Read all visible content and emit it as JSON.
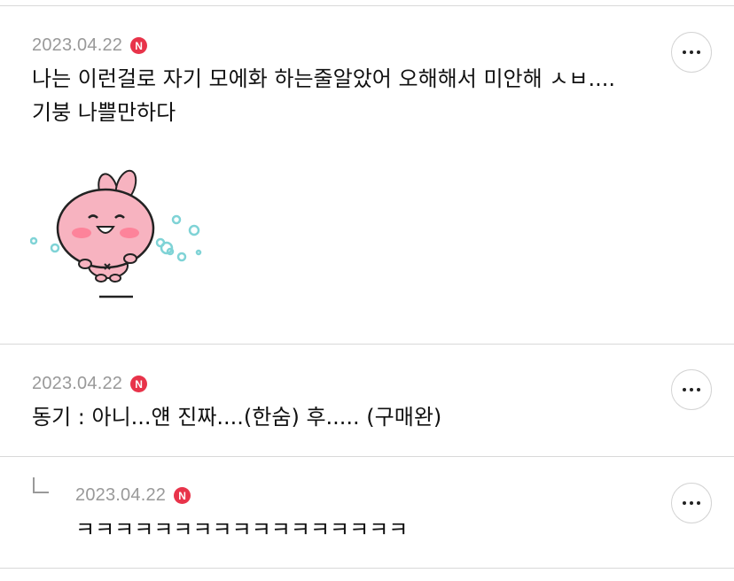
{
  "comments": [
    {
      "date": "2023.04.22",
      "badge": "N",
      "line1": "나는 이런걸로 자기 모에화 하는줄알았어 오해해서 미안해 ㅅㅂ....",
      "line2": "기붕 나쁠만하다",
      "sticker": "pink-bunny-sticker"
    },
    {
      "date": "2023.04.22",
      "badge": "N",
      "line1": "동기 : 아니...얜 진짜....(한숨) 후..... (구매완)"
    },
    {
      "date": "2023.04.22",
      "badge": "N",
      "line1": "ㅋㅋㅋㅋㅋㅋㅋㅋㅋㅋㅋㅋㅋㅋㅋㅋㅋ"
    }
  ],
  "icons": {
    "more": "more-options-icon",
    "reply": "reply-arrow-icon",
    "new": "new-badge-icon"
  },
  "colors": {
    "badge": "#e8334a",
    "date": "#999999",
    "divider": "#d9d9d9"
  }
}
